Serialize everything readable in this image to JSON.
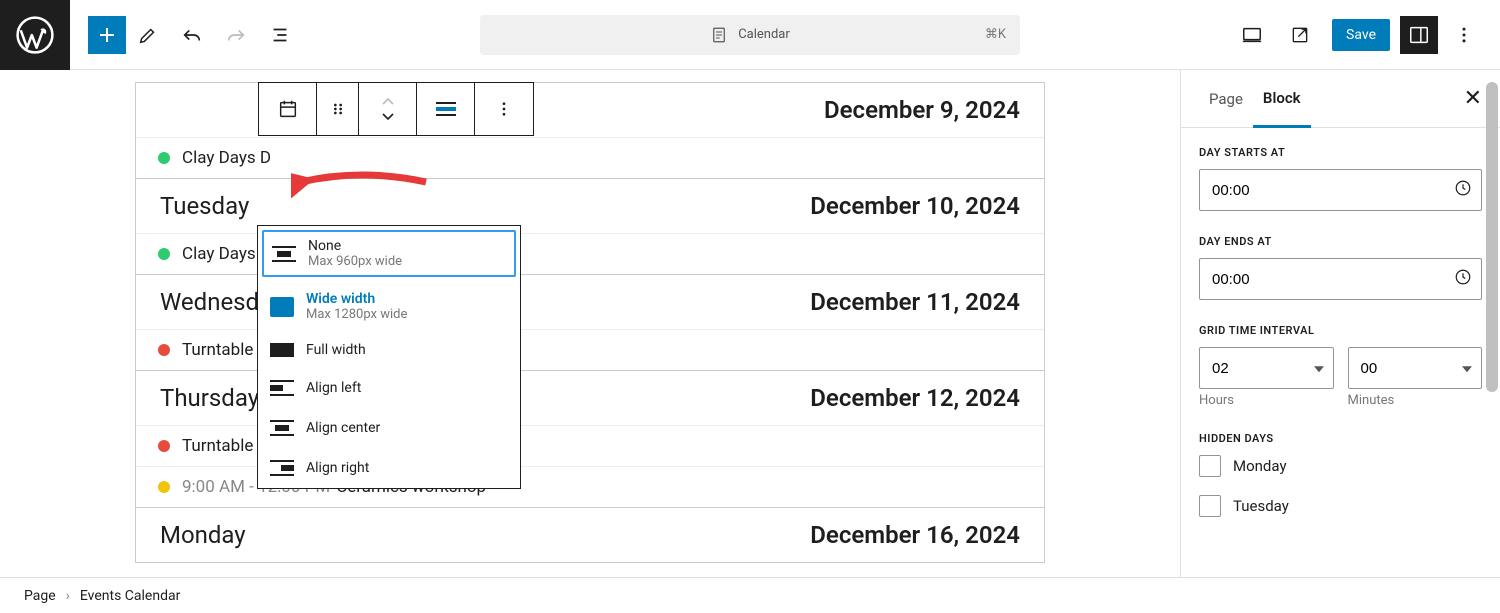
{
  "topbar": {
    "title": "Calendar",
    "shortcut": "⌘K",
    "save_label": "Save"
  },
  "block_toolbar": {
    "align_current": "wide"
  },
  "align_menu": {
    "items": [
      {
        "title": "None",
        "sub": "Max 960px wide",
        "kind": "none"
      },
      {
        "title": "Wide width",
        "sub": "Max 1280px wide",
        "kind": "wide"
      },
      {
        "title": "Full width",
        "sub": "",
        "kind": "full"
      },
      {
        "title": "Align left",
        "sub": "",
        "kind": "left"
      },
      {
        "title": "Align center",
        "sub": "",
        "kind": "center"
      },
      {
        "title": "Align right",
        "sub": "",
        "kind": "right"
      }
    ]
  },
  "calendar": {
    "days": [
      {
        "name": "",
        "date": "December 9, 2024",
        "events": [
          {
            "color": "#2ecc71",
            "time": "",
            "title": "Clay Days D"
          }
        ]
      },
      {
        "name": "Tuesday",
        "date": "December 10, 2024",
        "events": [
          {
            "color": "#2ecc71",
            "time": "",
            "title": "Clay Days I"
          }
        ]
      },
      {
        "name": "Wednesday",
        "date": "December 11, 2024",
        "events": [
          {
            "color": "#e74c3c",
            "time": "",
            "title": "Turntable t"
          }
        ]
      },
      {
        "name": "Thursday",
        "date": "December 12, 2024",
        "events": [
          {
            "color": "#e74c3c",
            "time": "",
            "title": "Turntable trial session"
          },
          {
            "color": "#f1c40f",
            "time": "9:00 AM - 12:00 PM",
            "title": "Ceramics workshop"
          }
        ]
      },
      {
        "name": "Monday",
        "date": "December 16, 2024",
        "events": []
      }
    ]
  },
  "sidebar": {
    "tabs": {
      "page": "Page",
      "block": "Block"
    },
    "day_starts_label": "DAY STARTS AT",
    "day_starts_value": "00:00",
    "day_ends_label": "DAY ENDS AT",
    "day_ends_value": "00:00",
    "grid_interval_label": "GRID TIME INTERVAL",
    "grid_hours_value": "02",
    "grid_hours_sub": "Hours",
    "grid_minutes_value": "00",
    "grid_minutes_sub": "Minutes",
    "hidden_days_label": "HIDDEN DAYS",
    "hidden_days": [
      "Monday",
      "Tuesday"
    ]
  },
  "breadcrumb": {
    "root": "Page",
    "current": "Events Calendar"
  }
}
